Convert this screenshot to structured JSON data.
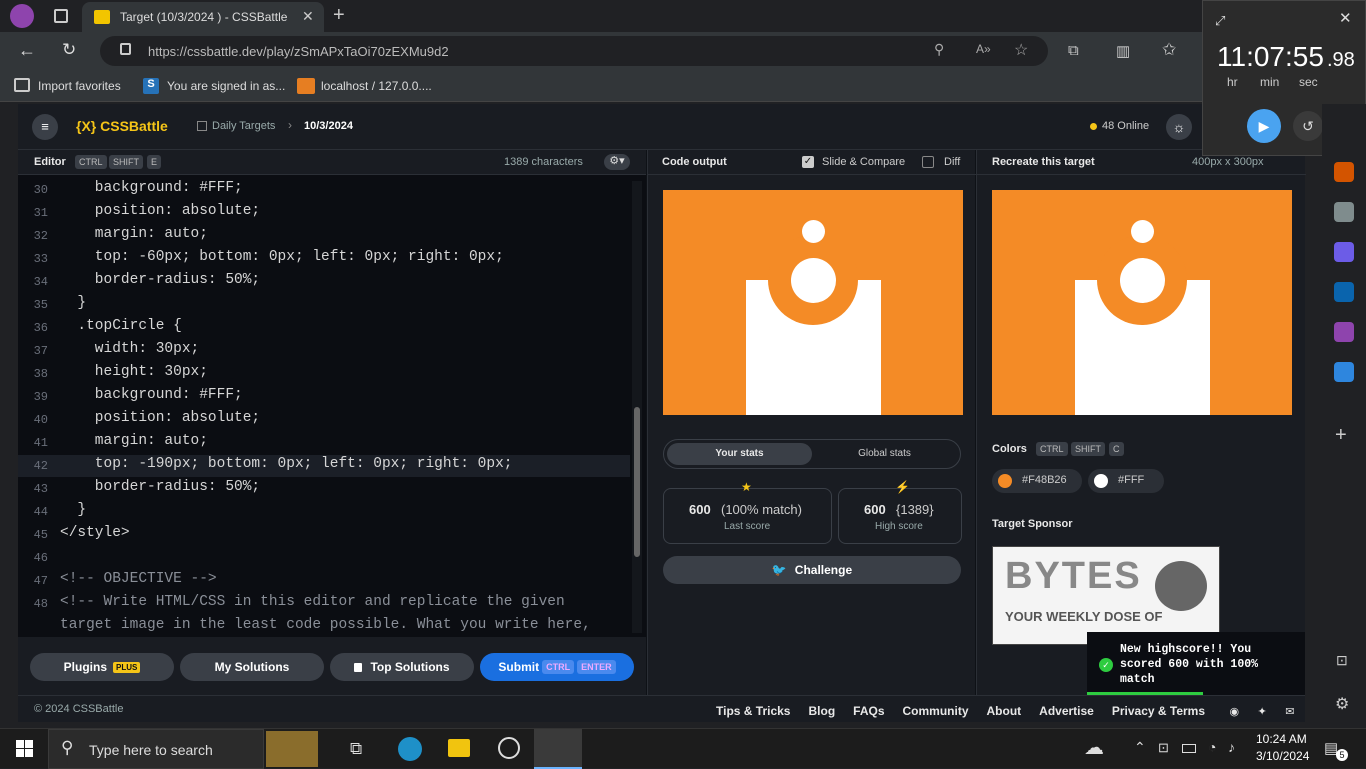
{
  "browser": {
    "tab_title": "Target (10/3/2024 ) - CSSBattle",
    "url": "https://cssbattle.dev/play/zSmAPxTaOi70zEXMu9d2",
    "favorites": [
      "Import favorites",
      "You are signed in as...",
      "localhost / 127.0.0...."
    ]
  },
  "clock": {
    "time": "11:07:55",
    "frac": ".98",
    "labels": [
      "hr",
      "min",
      "sec"
    ]
  },
  "app": {
    "logo": "{X} CSSBattle",
    "breadcrumb": {
      "parent": "Daily Targets",
      "current": "10/3/2024"
    },
    "online": "48 Online"
  },
  "editor": {
    "title": "Editor",
    "keys": [
      "CTRL",
      "SHIFT",
      "E"
    ],
    "chars": "1389 characters",
    "lines": [
      {
        "n": "30",
        "t": "    background: #FFF;"
      },
      {
        "n": "31",
        "t": "    position: absolute;"
      },
      {
        "n": "32",
        "t": "    margin: auto;"
      },
      {
        "n": "33",
        "t": "    top: -60px; bottom: 0px; left: 0px; right: 0px;"
      },
      {
        "n": "34",
        "t": "    border-radius: 50%;"
      },
      {
        "n": "35",
        "t": "  }"
      },
      {
        "n": "36",
        "t": "  .topCircle {"
      },
      {
        "n": "37",
        "t": "    width: 30px;"
      },
      {
        "n": "38",
        "t": "    height: 30px;"
      },
      {
        "n": "39",
        "t": "    background: #FFF;"
      },
      {
        "n": "40",
        "t": "    position: absolute;"
      },
      {
        "n": "41",
        "t": "    margin: auto;"
      },
      {
        "n": "42",
        "t": "    top: -190px; bottom: 0px; left: 0px; right: 0px;"
      },
      {
        "n": "43",
        "t": "    border-radius: 50%;"
      },
      {
        "n": "44",
        "t": "  }"
      },
      {
        "n": "45",
        "t": "</style>"
      },
      {
        "n": "46",
        "t": ""
      },
      {
        "n": "47",
        "t": "<!-- OBJECTIVE -->"
      },
      {
        "n": "48",
        "t": "<!-- Write HTML/CSS in this editor and replicate the given"
      },
      {
        "n": "",
        "t": "target image in the least code possible. What you write here,"
      }
    ],
    "buttons": {
      "plugins": "Plugins",
      "plus": "PLUS",
      "solutions": "My Solutions",
      "top": "Top Solutions",
      "submit": "Submit",
      "ctrl": "CTRL",
      "enter": "ENTER"
    }
  },
  "output": {
    "title": "Code output",
    "slide": "Slide & Compare",
    "diff": "Diff",
    "tabs": [
      "Your stats",
      "Global stats"
    ],
    "last_score": "600",
    "last_match": "(100% match)",
    "last_label": "Last score",
    "high_score": "600",
    "high_chars": "{1389}",
    "high_label": "High score",
    "challenge": "Challenge"
  },
  "target": {
    "title": "Recreate this target",
    "size": "400px x 300px",
    "colors_label": "Colors",
    "color_keys": [
      "CTRL",
      "SHIFT",
      "C"
    ],
    "colors": [
      "#F48B26",
      "#FFF"
    ],
    "sponsor_label": "Target Sponsor",
    "sponsor": {
      "big": "BYTES",
      "small": "YOUR WEEKLY DOSE OF"
    }
  },
  "toast": "New highscore!! You scored 600 with 100% match",
  "footer": {
    "copyright": "© 2024 CSSBattle",
    "links": [
      "Tips & Tricks",
      "Blog",
      "FAQs",
      "Community",
      "About",
      "Advertise",
      "Privacy & Terms"
    ]
  },
  "taskbar": {
    "search": "Type here to search",
    "time": "10:24 AM",
    "date": "3/10/2024",
    "badge": "5"
  },
  "accent": "#F48B26"
}
